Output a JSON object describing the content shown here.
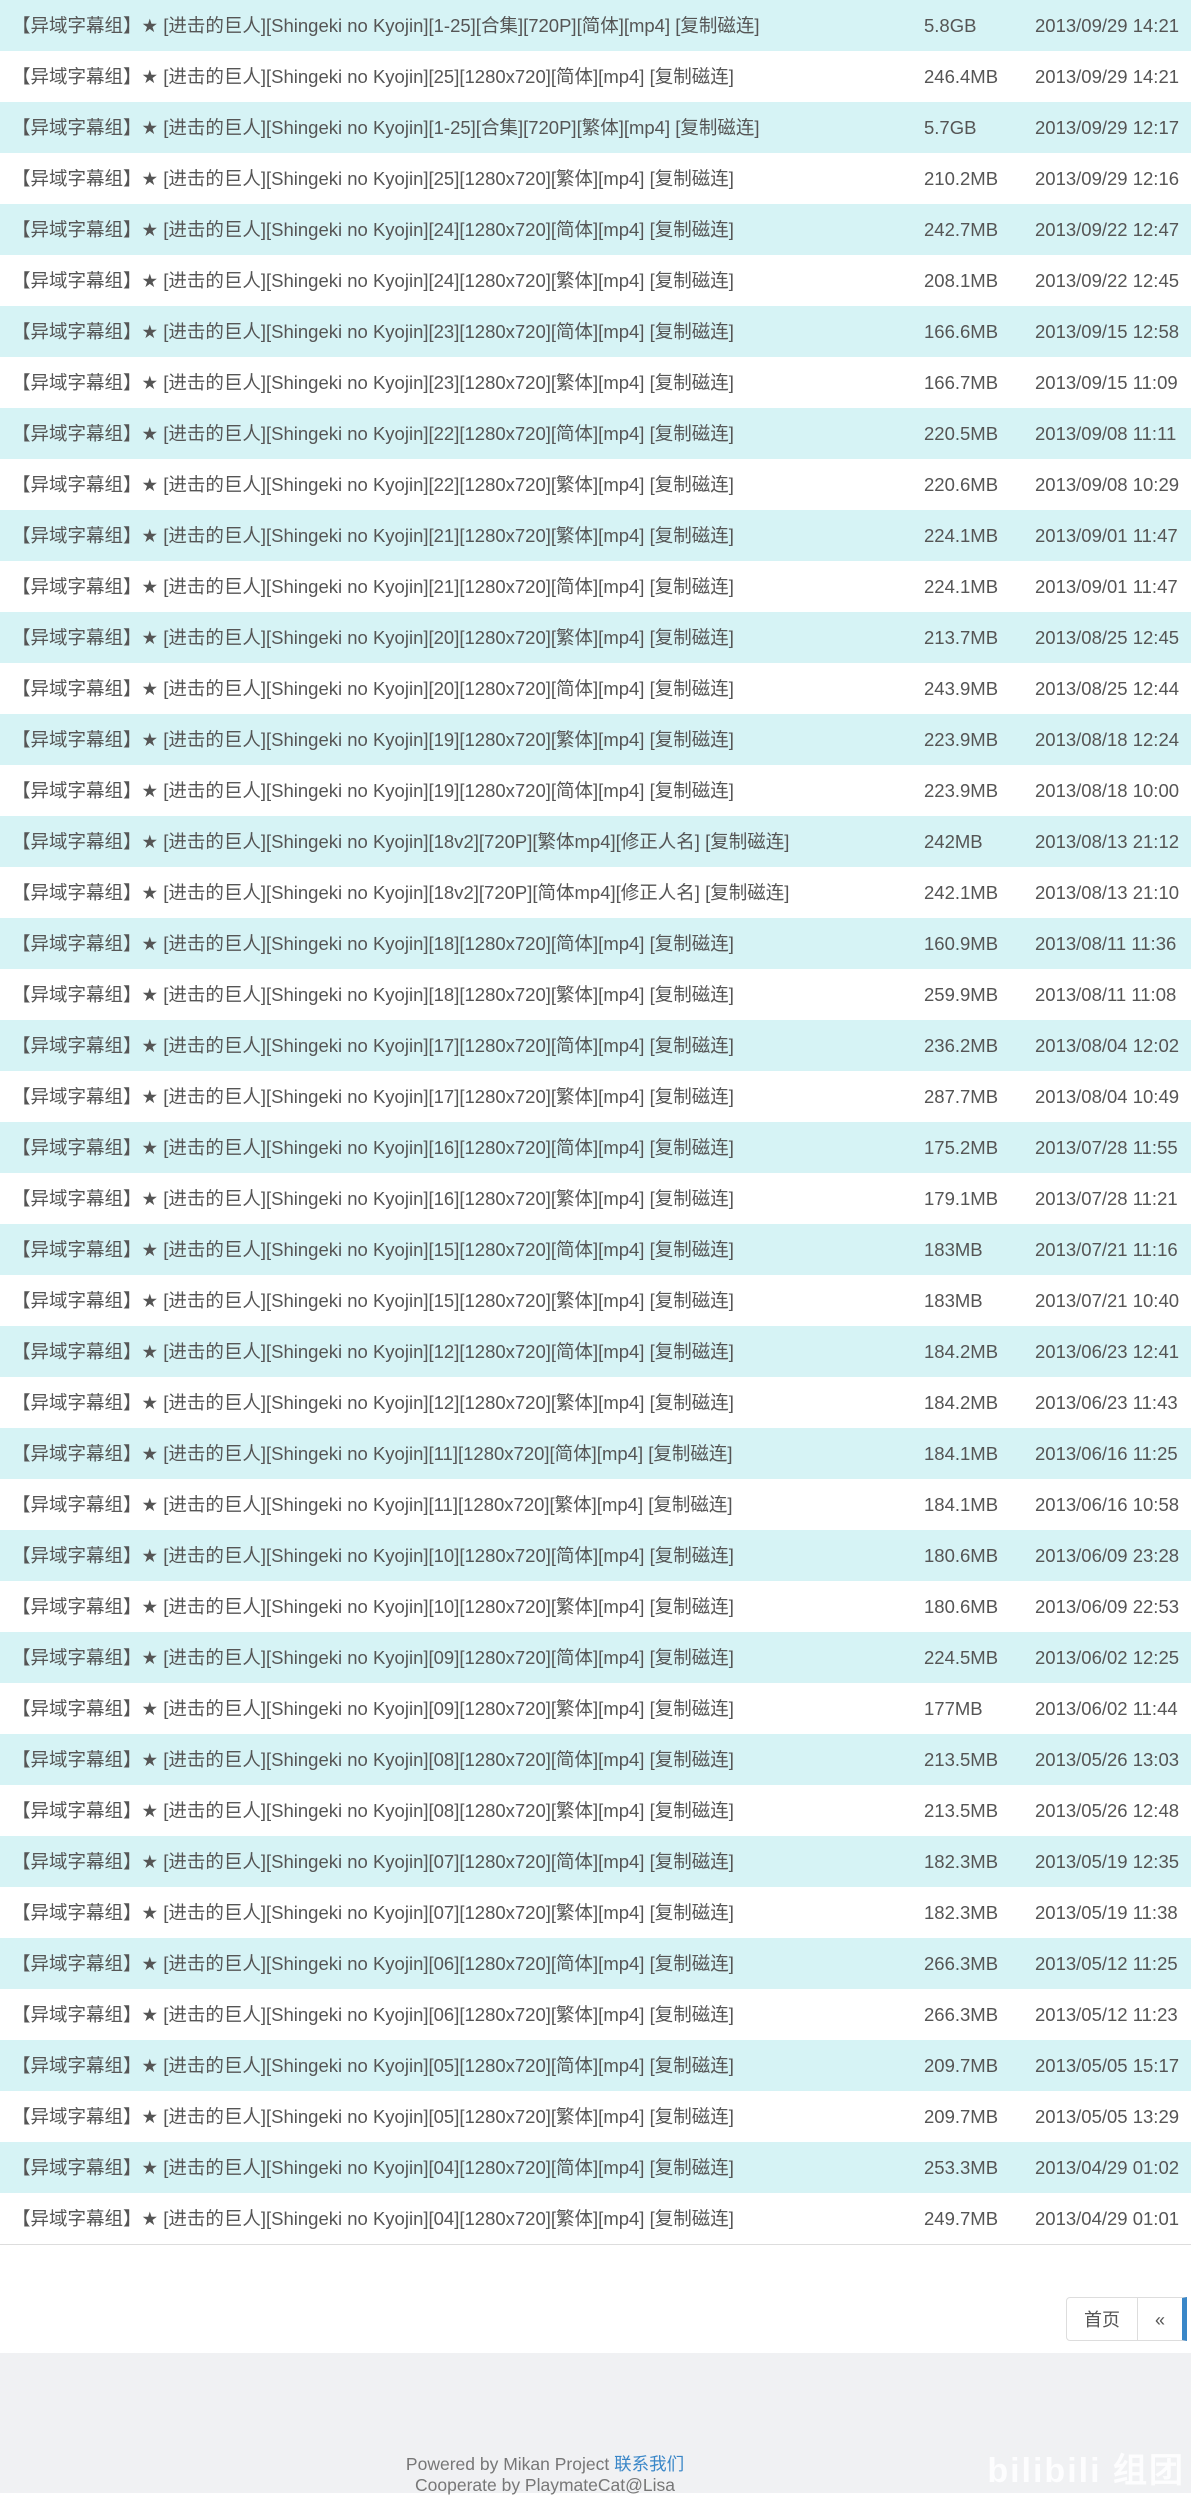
{
  "rows": [
    {
      "title": "【异域字幕组】★ [进击的巨人][Shingeki no Kyojin][1-25][合集][720P][简体][mp4] [复制磁连]",
      "size": "5.8GB",
      "date": "2013/09/29 14:21"
    },
    {
      "title": "【异域字幕组】★ [进击的巨人][Shingeki no Kyojin][25][1280x720][简体][mp4] [复制磁连]",
      "size": "246.4MB",
      "date": "2013/09/29 14:21"
    },
    {
      "title": "【异域字幕组】★ [进击的巨人][Shingeki no Kyojin][1-25][合集][720P][繁体][mp4] [复制磁连]",
      "size": "5.7GB",
      "date": "2013/09/29 12:17"
    },
    {
      "title": "【异域字幕组】★ [进击的巨人][Shingeki no Kyojin][25][1280x720][繁体][mp4] [复制磁连]",
      "size": "210.2MB",
      "date": "2013/09/29 12:16"
    },
    {
      "title": "【异域字幕组】★ [进击的巨人][Shingeki no Kyojin][24][1280x720][简体][mp4] [复制磁连]",
      "size": "242.7MB",
      "date": "2013/09/22 12:47"
    },
    {
      "title": "【异域字幕组】★ [进击的巨人][Shingeki no Kyojin][24][1280x720][繁体][mp4] [复制磁连]",
      "size": "208.1MB",
      "date": "2013/09/22 12:45"
    },
    {
      "title": "【异域字幕组】★ [进击的巨人][Shingeki no Kyojin][23][1280x720][简体][mp4] [复制磁连]",
      "size": "166.6MB",
      "date": "2013/09/15 12:58"
    },
    {
      "title": "【异域字幕组】★ [进击的巨人][Shingeki no Kyojin][23][1280x720][繁体][mp4] [复制磁连]",
      "size": "166.7MB",
      "date": "2013/09/15 11:09"
    },
    {
      "title": "【异域字幕组】★ [进击的巨人][Shingeki no Kyojin][22][1280x720][简体][mp4] [复制磁连]",
      "size": "220.5MB",
      "date": "2013/09/08 11:11"
    },
    {
      "title": "【异域字幕组】★ [进击的巨人][Shingeki no Kyojin][22][1280x720][繁体][mp4] [复制磁连]",
      "size": "220.6MB",
      "date": "2013/09/08 10:29"
    },
    {
      "title": "【异域字幕组】★ [进击的巨人][Shingeki no Kyojin][21][1280x720][繁体][mp4] [复制磁连]",
      "size": "224.1MB",
      "date": "2013/09/01 11:47"
    },
    {
      "title": "【异域字幕组】★ [进击的巨人][Shingeki no Kyojin][21][1280x720][简体][mp4] [复制磁连]",
      "size": "224.1MB",
      "date": "2013/09/01 11:47"
    },
    {
      "title": "【异域字幕组】★ [进击的巨人][Shingeki no Kyojin][20][1280x720][繁体][mp4] [复制磁连]",
      "size": "213.7MB",
      "date": "2013/08/25 12:45"
    },
    {
      "title": "【异域字幕组】★ [进击的巨人][Shingeki no Kyojin][20][1280x720][简体][mp4] [复制磁连]",
      "size": "243.9MB",
      "date": "2013/08/25 12:44"
    },
    {
      "title": "【异域字幕组】★ [进击的巨人][Shingeki no Kyojin][19][1280x720][繁体][mp4] [复制磁连]",
      "size": "223.9MB",
      "date": "2013/08/18 12:24"
    },
    {
      "title": "【异域字幕组】★ [进击的巨人][Shingeki no Kyojin][19][1280x720][简体][mp4] [复制磁连]",
      "size": "223.9MB",
      "date": "2013/08/18 10:00"
    },
    {
      "title": "【异域字幕组】★ [进击的巨人][Shingeki no Kyojin][18v2][720P][繁体mp4][修正人名] [复制磁连]",
      "size": "242MB",
      "date": "2013/08/13 21:12"
    },
    {
      "title": "【异域字幕组】★ [进击的巨人][Shingeki no Kyojin][18v2][720P][简体mp4][修正人名] [复制磁连]",
      "size": "242.1MB",
      "date": "2013/08/13 21:10"
    },
    {
      "title": "【异域字幕组】★ [进击的巨人][Shingeki no Kyojin][18][1280x720][简体][mp4] [复制磁连]",
      "size": "160.9MB",
      "date": "2013/08/11 11:36"
    },
    {
      "title": "【异域字幕组】★ [进击的巨人][Shingeki no Kyojin][18][1280x720][繁体][mp4] [复制磁连]",
      "size": "259.9MB",
      "date": "2013/08/11 11:08"
    },
    {
      "title": "【异域字幕组】★ [进击的巨人][Shingeki no Kyojin][17][1280x720][简体][mp4] [复制磁连]",
      "size": "236.2MB",
      "date": "2013/08/04 12:02"
    },
    {
      "title": "【异域字幕组】★ [进击的巨人][Shingeki no Kyojin][17][1280x720][繁体][mp4] [复制磁连]",
      "size": "287.7MB",
      "date": "2013/08/04 10:49"
    },
    {
      "title": "【异域字幕组】★ [进击的巨人][Shingeki no Kyojin][16][1280x720][简体][mp4] [复制磁连]",
      "size": "175.2MB",
      "date": "2013/07/28 11:55"
    },
    {
      "title": "【异域字幕组】★ [进击的巨人][Shingeki no Kyojin][16][1280x720][繁体][mp4] [复制磁连]",
      "size": "179.1MB",
      "date": "2013/07/28 11:21"
    },
    {
      "title": "【异域字幕组】★ [进击的巨人][Shingeki no Kyojin][15][1280x720][简体][mp4] [复制磁连]",
      "size": "183MB",
      "date": "2013/07/21 11:16"
    },
    {
      "title": "【异域字幕组】★ [进击的巨人][Shingeki no Kyojin][15][1280x720][繁体][mp4] [复制磁连]",
      "size": "183MB",
      "date": "2013/07/21 10:40"
    },
    {
      "title": "【异域字幕组】★ [进击的巨人][Shingeki no Kyojin][12][1280x720][简体][mp4] [复制磁连]",
      "size": "184.2MB",
      "date": "2013/06/23 12:41"
    },
    {
      "title": "【异域字幕组】★ [进击的巨人][Shingeki no Kyojin][12][1280x720][繁体][mp4] [复制磁连]",
      "size": "184.2MB",
      "date": "2013/06/23 11:43"
    },
    {
      "title": "【异域字幕组】★ [进击的巨人][Shingeki no Kyojin][11][1280x720][简体][mp4] [复制磁连]",
      "size": "184.1MB",
      "date": "2013/06/16 11:25"
    },
    {
      "title": "【异域字幕组】★ [进击的巨人][Shingeki no Kyojin][11][1280x720][繁体][mp4] [复制磁连]",
      "size": "184.1MB",
      "date": "2013/06/16 10:58"
    },
    {
      "title": "【异域字幕组】★ [进击的巨人][Shingeki no Kyojin][10][1280x720][简体][mp4] [复制磁连]",
      "size": "180.6MB",
      "date": "2013/06/09 23:28"
    },
    {
      "title": "【异域字幕组】★ [进击的巨人][Shingeki no Kyojin][10][1280x720][繁体][mp4] [复制磁连]",
      "size": "180.6MB",
      "date": "2013/06/09 22:53"
    },
    {
      "title": "【异域字幕组】★ [进击的巨人][Shingeki no Kyojin][09][1280x720][简体][mp4] [复制磁连]",
      "size": "224.5MB",
      "date": "2013/06/02 12:25"
    },
    {
      "title": "【异域字幕组】★ [进击的巨人][Shingeki no Kyojin][09][1280x720][繁体][mp4] [复制磁连]",
      "size": "177MB",
      "date": "2013/06/02 11:44"
    },
    {
      "title": "【异域字幕组】★ [进击的巨人][Shingeki no Kyojin][08][1280x720][简体][mp4] [复制磁连]",
      "size": "213.5MB",
      "date": "2013/05/26 13:03"
    },
    {
      "title": "【异域字幕组】★ [进击的巨人][Shingeki no Kyojin][08][1280x720][繁体][mp4] [复制磁连]",
      "size": "213.5MB",
      "date": "2013/05/26 12:48"
    },
    {
      "title": "【异域字幕组】★ [进击的巨人][Shingeki no Kyojin][07][1280x720][简体][mp4] [复制磁连]",
      "size": "182.3MB",
      "date": "2013/05/19 12:35"
    },
    {
      "title": "【异域字幕组】★ [进击的巨人][Shingeki no Kyojin][07][1280x720][繁体][mp4] [复制磁连]",
      "size": "182.3MB",
      "date": "2013/05/19 11:38"
    },
    {
      "title": "【异域字幕组】★ [进击的巨人][Shingeki no Kyojin][06][1280x720][简体][mp4] [复制磁连]",
      "size": "266.3MB",
      "date": "2013/05/12 11:25"
    },
    {
      "title": "【异域字幕组】★ [进击的巨人][Shingeki no Kyojin][06][1280x720][繁体][mp4] [复制磁连]",
      "size": "266.3MB",
      "date": "2013/05/12 11:23"
    },
    {
      "title": "【异域字幕组】★ [进击的巨人][Shingeki no Kyojin][05][1280x720][简体][mp4] [复制磁连]",
      "size": "209.7MB",
      "date": "2013/05/05 15:17"
    },
    {
      "title": "【异域字幕组】★ [进击的巨人][Shingeki no Kyojin][05][1280x720][繁体][mp4] [复制磁连]",
      "size": "209.7MB",
      "date": "2013/05/05 13:29"
    },
    {
      "title": "【异域字幕组】★ [进击的巨人][Shingeki no Kyojin][04][1280x720][简体][mp4] [复制磁连]",
      "size": "253.3MB",
      "date": "2013/04/29 01:02"
    },
    {
      "title": "【异域字幕组】★ [进击的巨人][Shingeki no Kyojin][04][1280x720][繁体][mp4] [复制磁连]",
      "size": "249.7MB",
      "date": "2013/04/29 01:01"
    }
  ],
  "pagination": {
    "first_label": "首页",
    "prev_label": "«"
  },
  "footer": {
    "powered_by": "Powered by Mikan Project ",
    "contact_label": "联系我们",
    "cooperate": "Cooperate by PlaymateCat@Lisa"
  },
  "watermark": {
    "text": "bilibili 组团"
  },
  "colors": {
    "row_stripe": "#d6f3f5",
    "row_plain": "#ffffff",
    "link_accent": "#3a87c8",
    "footer_bg": "#f0f1f3"
  }
}
